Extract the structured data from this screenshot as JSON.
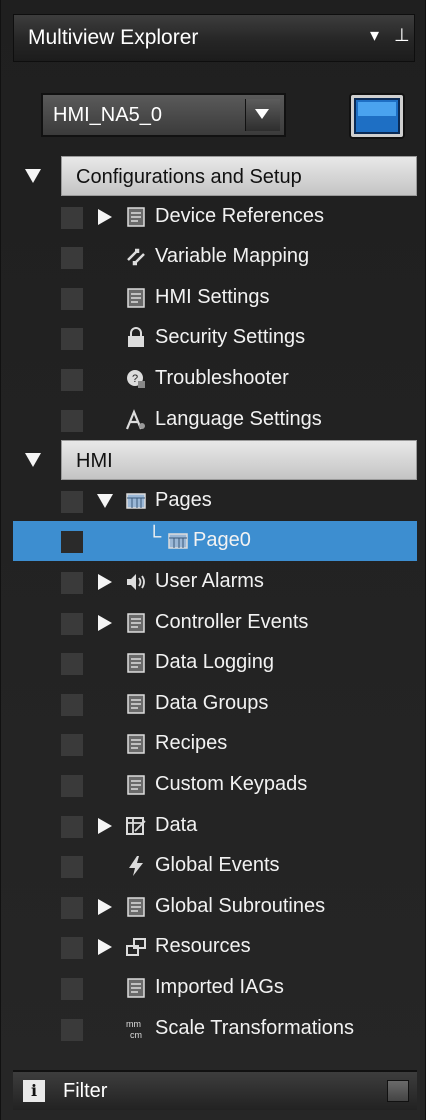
{
  "panel": {
    "title": "Multiview Explorer",
    "title_controls": [
      "▾",
      "⊥"
    ]
  },
  "device": {
    "selected": "HMI_NA5_0"
  },
  "sections": [
    {
      "label": "Configurations and Setup",
      "items": [
        {
          "label": "Device References",
          "icon": "device-references-icon",
          "expandable": true
        },
        {
          "label": "Variable Mapping",
          "icon": "variable-mapping-icon",
          "expandable": false
        },
        {
          "label": "HMI Settings",
          "icon": "hmi-settings-icon",
          "expandable": false
        },
        {
          "label": "Security Settings",
          "icon": "security-settings-icon",
          "expandable": false
        },
        {
          "label": "Troubleshooter",
          "icon": "troubleshooter-icon",
          "expandable": false
        },
        {
          "label": "Language Settings",
          "icon": "language-settings-icon",
          "expandable": false
        }
      ]
    },
    {
      "label": "HMI",
      "items": [
        {
          "label": "Pages",
          "icon": "pages-icon",
          "expanded": true
        },
        {
          "label": "Page0",
          "icon": "page-icon",
          "child": true,
          "selected": true
        },
        {
          "label": "User Alarms",
          "icon": "user-alarms-icon",
          "expandable": true
        },
        {
          "label": "Controller Events",
          "icon": "controller-events-icon",
          "expandable": true
        },
        {
          "label": "Data Logging",
          "icon": "data-logging-icon",
          "expandable": false
        },
        {
          "label": "Data Groups",
          "icon": "data-groups-icon",
          "expandable": false
        },
        {
          "label": "Recipes",
          "icon": "recipes-icon",
          "expandable": false
        },
        {
          "label": "Custom Keypads",
          "icon": "custom-keypads-icon",
          "expandable": false
        },
        {
          "label": "Data",
          "icon": "data-icon",
          "expandable": true
        },
        {
          "label": "Global Events",
          "icon": "global-events-icon",
          "expandable": false
        },
        {
          "label": "Global Subroutines",
          "icon": "global-subroutines-icon",
          "expandable": true
        },
        {
          "label": "Resources",
          "icon": "resources-icon",
          "expandable": true
        },
        {
          "label": "Imported IAGs",
          "icon": "imported-iags-icon",
          "expandable": false
        },
        {
          "label": "Scale Transformations",
          "icon": "scale-transformations-icon",
          "expandable": false
        }
      ]
    }
  ],
  "filter": {
    "label": "Filter",
    "info_glyph": "i"
  },
  "colors": {
    "selection": "#3d8ed0",
    "background": "#262626",
    "section_header": "#d6d6d6"
  }
}
